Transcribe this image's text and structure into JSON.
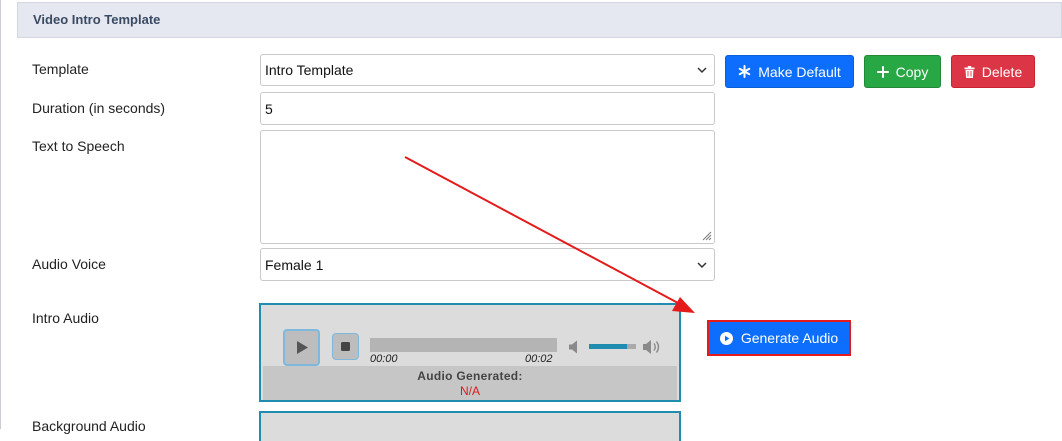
{
  "panel": {
    "title": "Video Intro Template"
  },
  "form": {
    "template_label": "Template",
    "template_value": "Intro Template",
    "duration_label": "Duration (in seconds)",
    "duration_value": "5",
    "tts_label": "Text to Speech",
    "tts_value": "",
    "voice_label": "Audio Voice",
    "voice_value": "Female 1",
    "intro_audio_label": "Intro Audio",
    "background_audio_label": "Background Audio"
  },
  "buttons": {
    "make_default": "Make Default",
    "copy": "Copy",
    "delete": "Delete",
    "generate_audio": "Generate Audio"
  },
  "player": {
    "current_time": "00:00",
    "total_time": "00:02",
    "progress": 0,
    "volume": 0.8,
    "generated_label": "Audio Generated:",
    "generated_value": "N/A"
  },
  "colors": {
    "primary": "#0d6efd",
    "success": "#28a745",
    "danger": "#dc3545",
    "annotation": "#e31b1b",
    "player_border": "#1f8cb0"
  }
}
